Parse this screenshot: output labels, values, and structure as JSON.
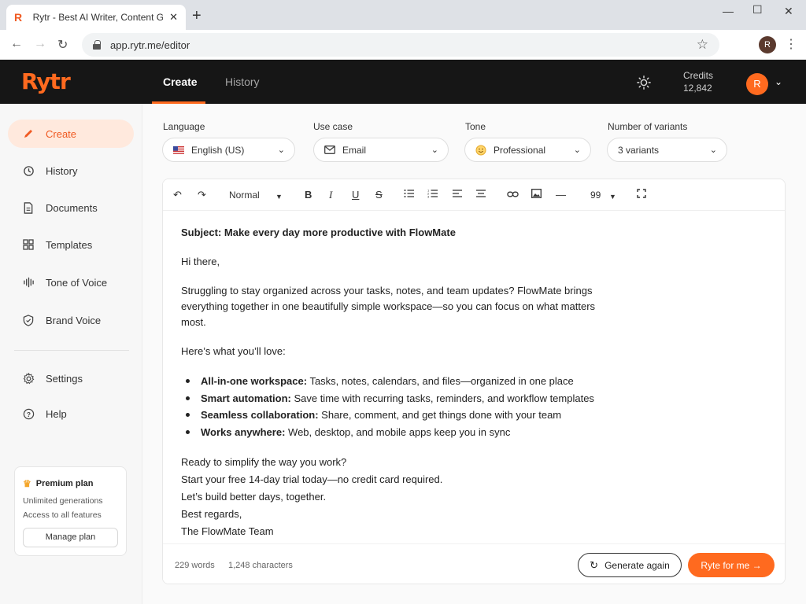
{
  "browser": {
    "tab_title": "Rytr - Best AI Writer, Content Generator",
    "tab_favicon": "R",
    "url": "app.rytr.me/editor",
    "profile_initial": "R"
  },
  "header": {
    "logo": "Rytr",
    "nav": [
      {
        "label": "Create",
        "active": true
      },
      {
        "label": "History",
        "active": false
      }
    ],
    "credits_label": "Credits",
    "credits_value": "12,842",
    "user_initial": "R",
    "accent_color": "#ff6a1f"
  },
  "sidebar": {
    "items": [
      {
        "label": "Create",
        "icon": "pencil-icon",
        "active": true
      },
      {
        "label": "History",
        "icon": "history-icon",
        "active": false
      },
      {
        "label": "Documents",
        "icon": "document-icon",
        "active": false
      },
      {
        "label": "Templates",
        "icon": "grid-icon",
        "active": false
      },
      {
        "label": "Tone of Voice",
        "icon": "waveform-icon",
        "active": false
      },
      {
        "label": "Brand Voice",
        "icon": "shield-icon",
        "active": false
      },
      {
        "label": "Settings",
        "icon": "gear-icon",
        "active": false
      },
      {
        "label": "Help",
        "icon": "help-icon",
        "active": false
      }
    ],
    "premium": {
      "title": "Premium plan",
      "line1": "Unlimited generations",
      "line2": "Access to all features",
      "button": "Manage plan"
    }
  },
  "options": {
    "language": {
      "label": "Language",
      "value": "English (US)"
    },
    "use_case": {
      "label": "Use case",
      "value": "Email"
    },
    "tone": {
      "label": "Tone",
      "value": "Professional"
    },
    "variants": {
      "label": "Number of variants",
      "value": "3 variants"
    }
  },
  "toolbar": {
    "style": "Normal",
    "quote": "99"
  },
  "content": {
    "subject": "Subject: Make every day more productive with FlowMate",
    "greeting": "Hi there,",
    "intro": "Struggling to stay organized across your tasks, notes, and team updates? FlowMate brings everything together in one beautifully simple workspace—so you can focus on what matters most.",
    "love": "Here’s what you’ll love:",
    "bullets": [
      {
        "bold": "All-in-one workspace:",
        "text": " Tasks, notes, calendars, and files—organized in one place"
      },
      {
        "bold": "Smart automation:",
        "text": " Save time with recurring tasks, reminders, and workflow templates"
      },
      {
        "bold": "Seamless collaboration:",
        "text": " Share, comment, and get things done with your team"
      },
      {
        "bold": "Works anywhere:",
        "text": " Web, desktop, and mobile apps keep you in sync"
      }
    ],
    "closing": [
      "Ready to simplify the way you work?",
      "Start your free 14-day trial today—no credit card required.",
      "Let’s build better days, together.",
      "Best regards,",
      "The FlowMate Team"
    ]
  },
  "footer": {
    "words": "229 words",
    "characters": "1,248 characters",
    "generate_again": "Generate again",
    "ryte": "Ryte for me →"
  }
}
